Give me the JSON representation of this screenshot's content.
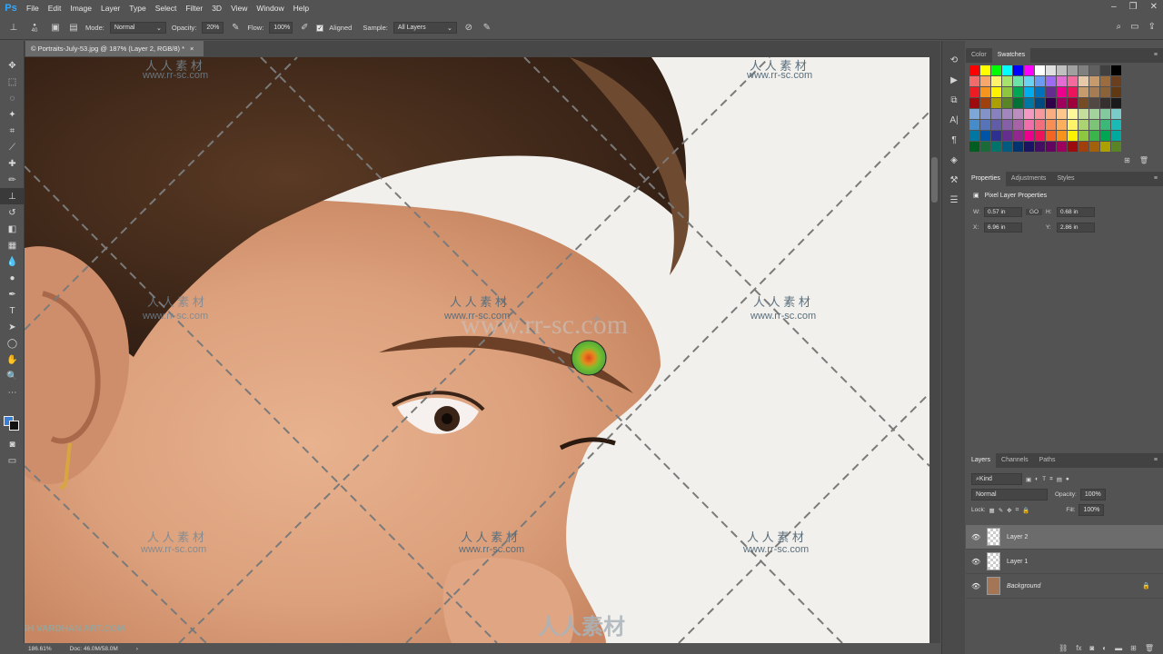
{
  "app": {
    "logo": "Ps"
  },
  "menu": [
    "File",
    "Edit",
    "Image",
    "Layer",
    "Type",
    "Select",
    "Filter",
    "3D",
    "View",
    "Window",
    "Help"
  ],
  "window_controls": [
    "–",
    "❐",
    "✕"
  ],
  "options": {
    "brush_size": "40",
    "mode_label": "Mode:",
    "mode_value": "Normal",
    "opacity_label": "Opacity:",
    "opacity_value": "20%",
    "flow_label": "Flow:",
    "flow_value": "100%",
    "aligned_label": "Aligned",
    "sample_label": "Sample:",
    "sample_value": "All Layers"
  },
  "document_tab": {
    "title": "© Portraits-July-53.jpg @ 187% (Layer 2, RGB/8) *",
    "close": "×"
  },
  "status": {
    "zoom": "186.61%",
    "doc": "Doc: 46.0M/58.0M",
    "arrow": "›"
  },
  "watermark": {
    "cn": "人 人 素 材",
    "url": "www.rr-sc.com",
    "center_url": "www.rr-sc.com",
    "bottom_brand": "人人素材",
    "bottom_left": "ARSH VARDHAN ART.COM"
  },
  "swatches_panel": {
    "tabs": [
      "Color",
      "Swatches"
    ],
    "active": "Swatches"
  },
  "properties_panel": {
    "tabs": [
      "Properties",
      "Adjustments",
      "Styles"
    ],
    "title": "Pixel Layer Properties",
    "w_label": "W:",
    "w_value": "0.57 in",
    "h_label": "H:",
    "h_value": "0.68 in",
    "x_label": "X:",
    "x_value": "6.96 in",
    "y_label": "Y:",
    "y_value": "2.86 in",
    "link": "GO"
  },
  "layers_panel": {
    "tabs": [
      "Layers",
      "Channels",
      "Paths"
    ],
    "kind": "Kind",
    "blend_mode": "Normal",
    "opacity_label": "Opacity:",
    "opacity_value": "100%",
    "lock_label": "Lock:",
    "fill_label": "Fill:",
    "fill_value": "100%",
    "layers": [
      {
        "name": "Layer 2",
        "selected": true
      },
      {
        "name": "Layer 1",
        "selected": false
      },
      {
        "name": "Background",
        "selected": false
      }
    ]
  },
  "colors": {
    "accent": "#31a8ff",
    "foreground": "#3a7fd3",
    "background": "#111111",
    "ui": "#535353"
  }
}
